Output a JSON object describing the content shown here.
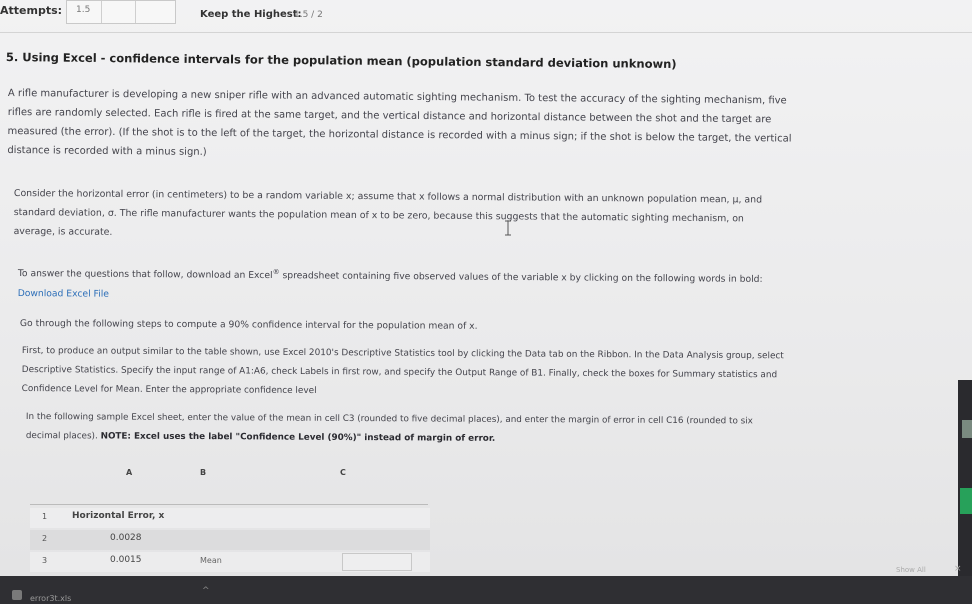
{
  "header": {
    "attempts_label": "Attempts:",
    "attempts_value": "1.5",
    "keep_label": "Keep the Highest:",
    "keep_value": "1.5 / 2"
  },
  "question": {
    "title": "5. Using Excel - confidence intervals for the population mean (population standard deviation unknown)",
    "p1": "A rifle manufacturer is developing a new sniper rifle with an advanced automatic sighting mechanism. To test the accuracy of the sighting mechanism, five rifles are randomly selected. Each rifle is fired at the same target, and the vertical distance and horizontal distance between the shot and the target are measured (the error). (If the shot is to the left of the target, the horizontal distance is recorded with a minus sign; if the shot is below the target, the vertical distance is recorded with a minus sign.)",
    "p2": "Consider the horizontal error (in centimeters) to be a random variable x; assume that x follows a normal distribution with an unknown population mean, μ, and standard deviation, σ. The rifle manufacturer wants the population mean of x to be zero, because this suggests that the automatic sighting mechanism, on average, is accurate.",
    "p3_a": "To answer the questions that follow, download an Excel",
    "p3_reg": "®",
    "p3_b": " spreadsheet containing five observed values of the variable x by clicking on the following words in bold: ",
    "p3_link": "Download Excel File",
    "p4": "Go through the following steps to compute a 90% confidence interval for the population mean of x.",
    "p5": "First, to produce an output similar to the table shown, use Excel 2010's Descriptive Statistics tool by clicking the Data tab on the Ribbon. In the Data Analysis group, select Descriptive Statistics. Specify the input range of A1:A6, check Labels in first row, and specify the Output Range of B1. Finally, check the boxes for Summary statistics and Confidence Level for Mean. Enter the appropriate confidence level",
    "p6_a": "In the following sample Excel sheet, enter the value of the mean in cell C3 (rounded to five decimal places), and enter the margin of error in cell C16 (rounded to six decimal places). ",
    "p6_b": "NOTE: Excel uses the label \"Confidence Level (90%)\" instead of margin of error."
  },
  "sheet": {
    "columns": [
      "A",
      "B",
      "C"
    ],
    "rows": [
      {
        "num": "1",
        "a": "Horizontal Error, x",
        "b": ""
      },
      {
        "num": "2",
        "a": "0.0028",
        "b": ""
      },
      {
        "num": "3",
        "a": "0.0015",
        "b": "Mean"
      }
    ]
  },
  "downloads": {
    "file": "error3t.xls",
    "show_all": "Show All",
    "close": "×"
  }
}
